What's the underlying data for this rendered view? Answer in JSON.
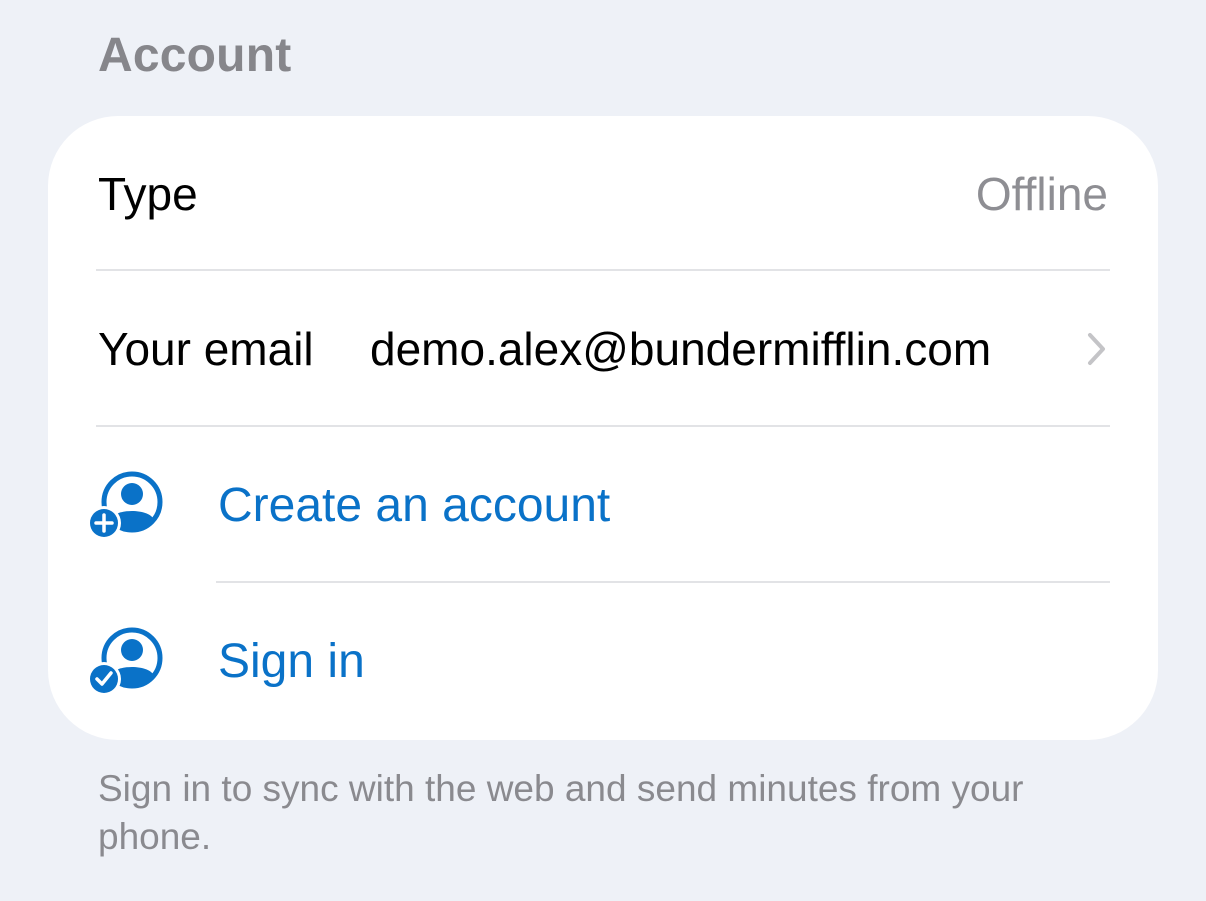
{
  "section": {
    "title": "Account"
  },
  "rows": {
    "type": {
      "label": "Type",
      "value": "Offline"
    },
    "email": {
      "label": "Your email",
      "value": "demo.alex@bundermifflin.com"
    }
  },
  "actions": {
    "create": {
      "label": "Create an account",
      "icon": "person-add-icon"
    },
    "signin": {
      "label": "Sign in",
      "icon": "person-check-icon"
    }
  },
  "footer": {
    "note": "Sign in to sync with the web and send minutes from your phone."
  },
  "colors": {
    "background": "#eef1f7",
    "card": "#ffffff",
    "accent": "#0a72c8",
    "secondary_text": "#8e8e93",
    "divider": "#e2e3e6"
  }
}
